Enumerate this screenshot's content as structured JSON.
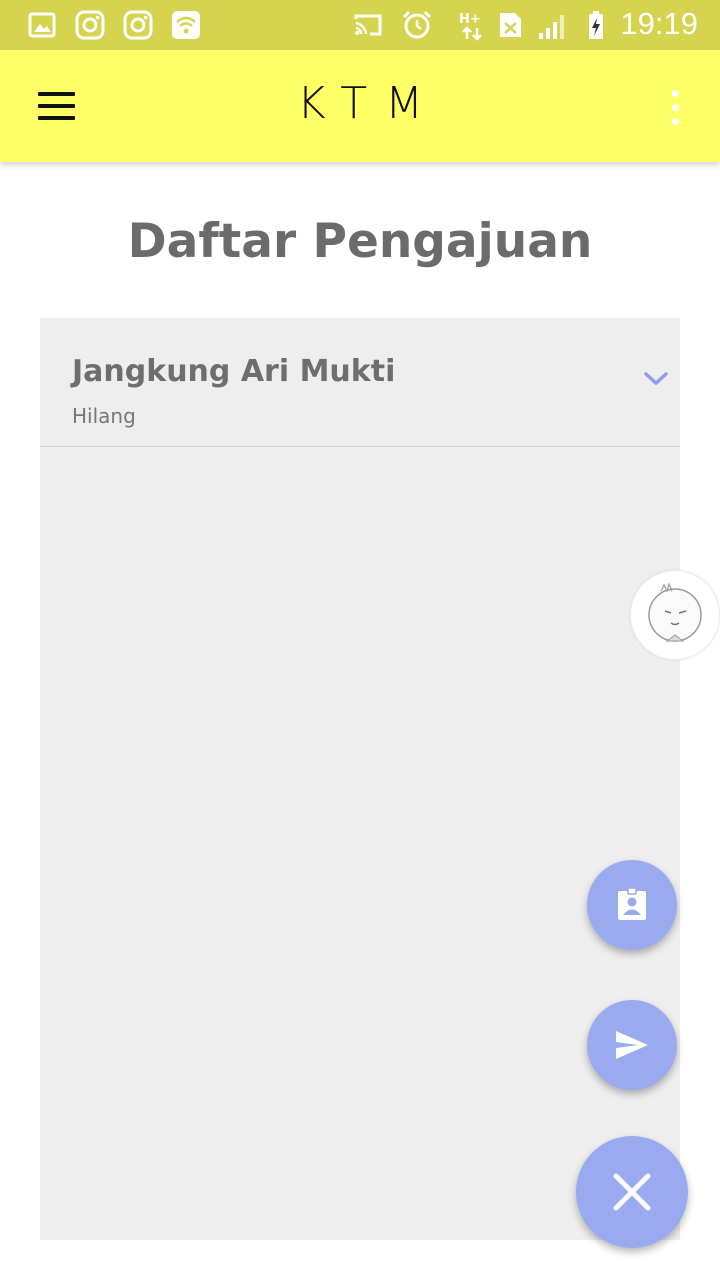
{
  "status_bar": {
    "time": "19:19",
    "icons": [
      "gallery-icon",
      "instagram-icon",
      "instagram-icon",
      "wifi-icon",
      "cast-icon",
      "alarm-icon",
      "network-hplus-icon",
      "sim-icon",
      "signal-icon",
      "battery-charging-icon"
    ],
    "bar_color": "#d6d34f"
  },
  "app_bar": {
    "logo_text": "KTM",
    "menu_icon": "hamburger-menu-icon",
    "overflow_icon": "more-vert-icon",
    "bar_color": "#ffff66"
  },
  "page": {
    "title": "Daftar Pengajuan"
  },
  "list": {
    "items": [
      {
        "name": "Jangkung Ari Mukti",
        "status": "Hilang",
        "expand_icon": "chevron-down-icon"
      }
    ]
  },
  "fabs": {
    "icons": [
      "assignment-ind-icon",
      "send-icon",
      "close-icon"
    ],
    "color": "#9aaaee"
  }
}
